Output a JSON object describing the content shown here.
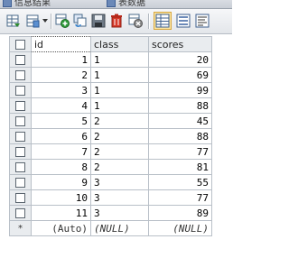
{
  "tabs": [
    "信息结果",
    "表数据"
  ],
  "toolbar": {
    "icons": [
      "export-grid-icon",
      "save-query-icon",
      "add-row-icon",
      "duplicate-row-icon",
      "save-icon",
      "delete-icon",
      "cancel-icon",
      "grid-view-icon",
      "form-view-icon",
      "text-view-icon"
    ]
  },
  "columns": [
    "id",
    "class",
    "scores"
  ],
  "rows": [
    {
      "id": "1",
      "class": "1",
      "scores": "20"
    },
    {
      "id": "2",
      "class": "1",
      "scores": "69"
    },
    {
      "id": "3",
      "class": "1",
      "scores": "99"
    },
    {
      "id": "4",
      "class": "1",
      "scores": "88"
    },
    {
      "id": "5",
      "class": "2",
      "scores": "45"
    },
    {
      "id": "6",
      "class": "2",
      "scores": "88"
    },
    {
      "id": "7",
      "class": "2",
      "scores": "77"
    },
    {
      "id": "8",
      "class": "2",
      "scores": "81"
    },
    {
      "id": "9",
      "class": "3",
      "scores": "55"
    },
    {
      "id": "10",
      "class": "3",
      "scores": "77"
    },
    {
      "id": "11",
      "class": "3",
      "scores": "89"
    }
  ],
  "new_row": {
    "marker": "*",
    "id": "(Auto)",
    "class": "(NULL)",
    "scores": "(NULL)"
  },
  "colors": {
    "header_bg": "#e9ecef",
    "grid_line": "#b9c0c8",
    "active_button": "#fbe6a4"
  }
}
